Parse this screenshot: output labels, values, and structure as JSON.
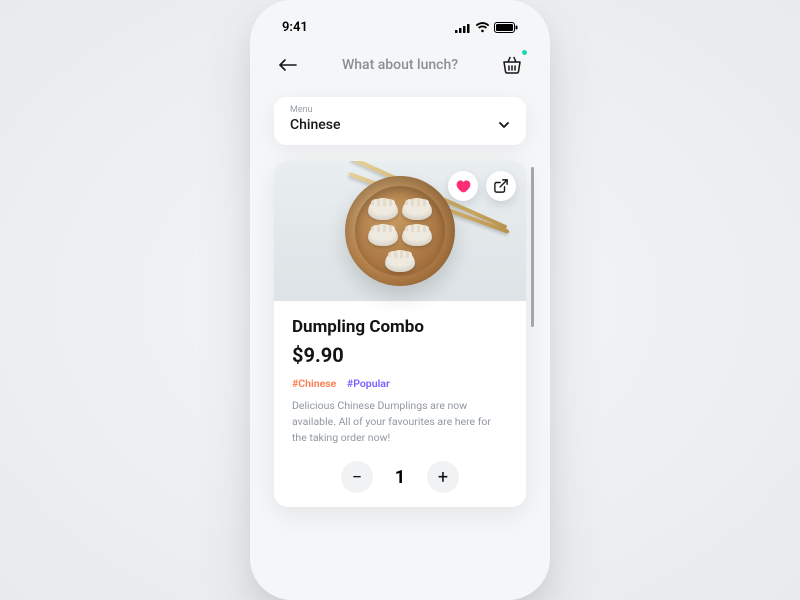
{
  "status": {
    "time": "9:41"
  },
  "header": {
    "title": "What about lunch?"
  },
  "menu_select": {
    "label": "Menu",
    "value": "Chinese"
  },
  "product": {
    "name": "Dumpling Combo",
    "price": "$9.90",
    "tag1": "#Chinese",
    "tag2": "#Popular",
    "description": "Delicious Chinese Dumplings are now available. All of your favourites are here for the taking order now!",
    "quantity": "1"
  }
}
